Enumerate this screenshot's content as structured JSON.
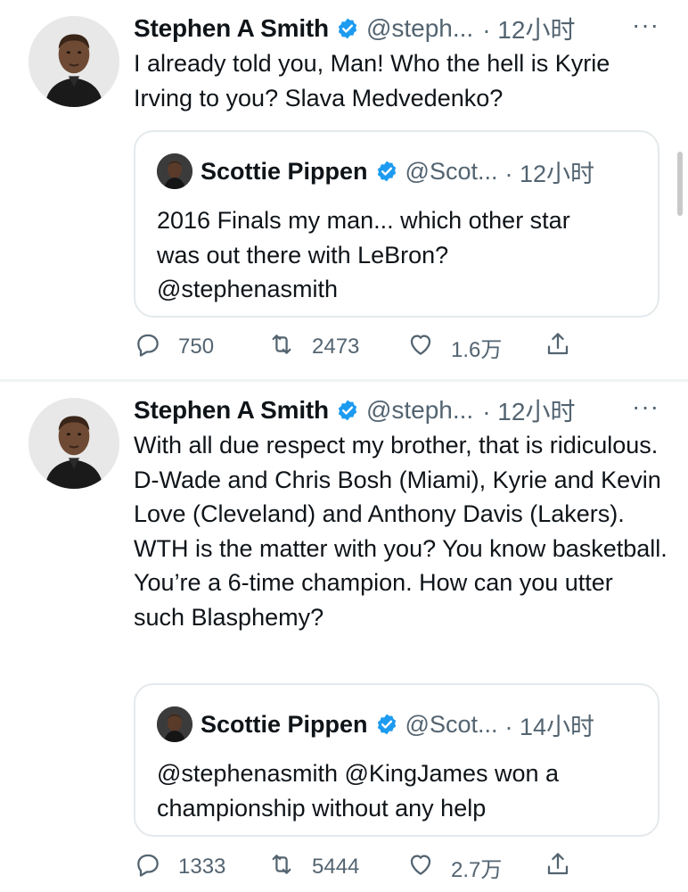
{
  "tweets": [
    {
      "author": {
        "name": "Stephen A Smith",
        "handle": "@steph...",
        "time": "· 12小时",
        "avatar_icon": "user-avatar"
      },
      "more_label": "···",
      "text": "I already told you, Man! Who the hell is Kyrie Irving to you? Slava Medvedenko?",
      "quote": {
        "author": {
          "name": "Scottie Pippen",
          "handle": "@Scot...",
          "time": "· 12小时"
        },
        "text_lines": [
          "2016 Finals my man... which other star",
          "was out there with LeBron?",
          "@stephenasmith"
        ]
      },
      "stats": {
        "replies": "750",
        "retweets": "2473",
        "likes": "1.6万"
      }
    },
    {
      "author": {
        "name": "Stephen A Smith",
        "handle": "@steph...",
        "time": "· 12小时",
        "avatar_icon": "user-avatar"
      },
      "more_label": "···",
      "text": "With all due respect my brother, that is ridiculous. D-Wade and Chris Bosh (Miami), Kyrie and Kevin Love (Cleveland) and Anthony Davis (Lakers). WTH is the matter with you? You know basketball. You’re a 6-time champion. How can you utter such Blasphemy?",
      "quote": {
        "author": {
          "name": "Scottie Pippen",
          "handle": "@Scot...",
          "time": "· 14小时"
        },
        "text_lines": [
          "@stephenasmith @KingJames won a",
          "championship without any help"
        ]
      },
      "stats": {
        "replies": "1333",
        "retweets": "5444",
        "likes": "2.7万"
      }
    }
  ],
  "colors": {
    "verified": "#1d9bf0",
    "muted": "#536471",
    "border": "#e4e9ec"
  }
}
